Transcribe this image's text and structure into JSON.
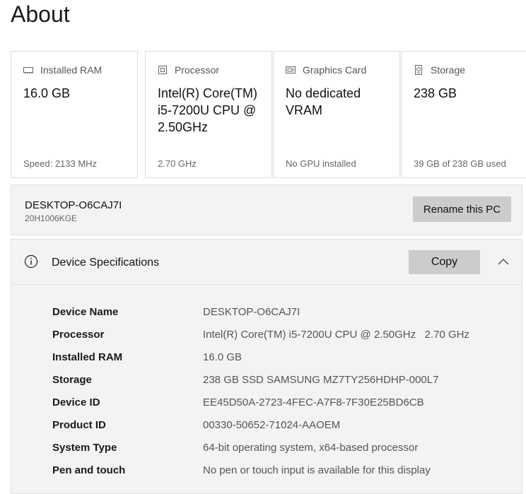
{
  "page": {
    "title": "About"
  },
  "cards": [
    {
      "icon": "ram-icon",
      "label": "Installed RAM",
      "value": "16.0 GB",
      "footer": "Speed: 2133 MHz"
    },
    {
      "icon": "processor-icon",
      "label": "Processor",
      "value": "Intel(R) Core(TM) i5-7200U CPU @ 2.50GHz",
      "footer": "2.70 GHz"
    },
    {
      "icon": "graphics-card-icon",
      "label": "Graphics Card",
      "value": "No dedicated VRAM",
      "footer": "No GPU installed"
    },
    {
      "icon": "storage-icon",
      "label": "Storage",
      "value": "238 GB",
      "footer": "39 GB of 238 GB used"
    }
  ],
  "pc": {
    "name": "DESKTOP-O6CAJ7I",
    "model": "20H1006KGE",
    "rename_label": "Rename this PC"
  },
  "specs": {
    "title": "Device Specifications",
    "copy_label": "Copy",
    "rows": [
      {
        "label": "Device Name",
        "value": "DESKTOP-O6CAJ7I"
      },
      {
        "label": "Processor",
        "value": "Intel(R) Core(TM) i5-7200U CPU @ 2.50GHz   2.70 GHz"
      },
      {
        "label": "Installed RAM",
        "value": "16.0 GB"
      },
      {
        "label": "Storage",
        "value": "238 GB SSD SAMSUNG MZ7TY256HDHP-000L7"
      },
      {
        "label": "Device ID",
        "value": "EE45D50A-2723-4FEC-A7F8-7F30E25BD6CB"
      },
      {
        "label": "Product ID",
        "value": "00330-50652-71024-AAOEM"
      },
      {
        "label": "System Type",
        "value": "64-bit operating system, x64-based processor"
      },
      {
        "label": "Pen and touch",
        "value": "No pen or touch input is available for this display"
      }
    ]
  },
  "colors": {
    "button_bg": "#cccccc",
    "panel_bg": "#f3f3f3",
    "border": "#dcdcdc"
  }
}
